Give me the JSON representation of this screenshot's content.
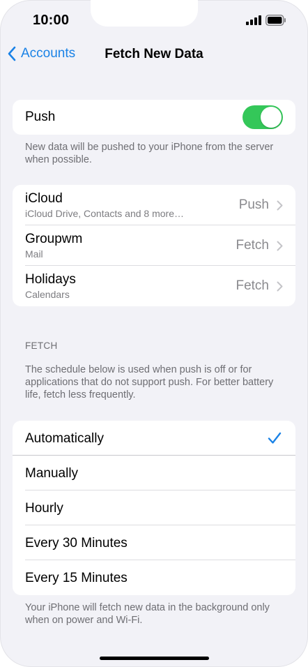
{
  "status_bar": {
    "time": "10:00"
  },
  "nav": {
    "back_label": "Accounts",
    "title": "Fetch New Data"
  },
  "push": {
    "label": "Push",
    "enabled": true,
    "footnote": "New data will be pushed to your iPhone from the server when possible."
  },
  "accounts": [
    {
      "title": "iCloud",
      "subtitle": "iCloud Drive, Contacts and 8 more…",
      "value": "Push"
    },
    {
      "title": "Groupwm",
      "subtitle": "Mail",
      "value": "Fetch"
    },
    {
      "title": "Holidays",
      "subtitle": "Calendars",
      "value": "Fetch"
    }
  ],
  "fetch": {
    "header": "FETCH",
    "description": "The schedule below is used when push is off or for applications that do not support push. For better battery life, fetch less frequently.",
    "options": [
      "Automatically",
      "Manually",
      "Hourly",
      "Every 30 Minutes",
      "Every 15 Minutes"
    ],
    "selected": "Automatically",
    "footnote": "Your iPhone will fetch new data in the background only when on power and Wi-Fi."
  },
  "colors": {
    "accent": "#1a82e6",
    "toggle_on": "#34c759",
    "background": "#f2f2f7"
  },
  "icons": [
    "chevron-left-icon",
    "signal-icon",
    "battery-icon",
    "chevron-right-icon",
    "checkmark-icon"
  ]
}
